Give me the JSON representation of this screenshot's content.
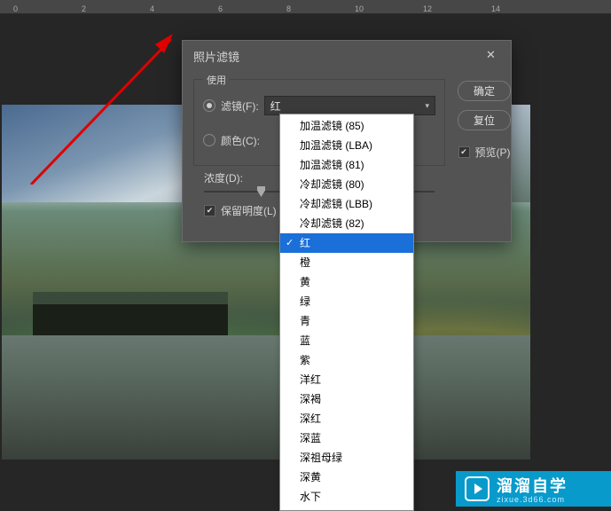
{
  "ruler": {
    "marks": [
      "0",
      "2",
      "4",
      "6",
      "8",
      "10",
      "12",
      "14"
    ]
  },
  "dialog": {
    "title": "照片滤镜",
    "close_glyph": "✕",
    "fieldset_label": "使用",
    "filter_label": "滤镜(F):",
    "color_label": "颜色(C):",
    "selected_filter": "红",
    "density_label": "浓度(D):",
    "density_value": "25",
    "density_unit": "%",
    "preserve_label": "保留明度(L)",
    "preserve_checked": true,
    "ok_label": "确定",
    "reset_label": "复位",
    "preview_label": "预览(P)",
    "preview_checked": true
  },
  "dropdown": {
    "items": [
      "加温滤镜 (85)",
      "加温滤镜 (LBA)",
      "加温滤镜 (81)",
      "冷却滤镜 (80)",
      "冷却滤镜 (LBB)",
      "冷却滤镜 (82)",
      "红",
      "橙",
      "黄",
      "绿",
      "青",
      "蓝",
      "紫",
      "洋红",
      "深褐",
      "深红",
      "深蓝",
      "深祖母绿",
      "深黄",
      "水下"
    ],
    "selected_index": 6
  },
  "watermark": {
    "brand": "溜溜自学",
    "sub": "zixue.3d66.com"
  }
}
